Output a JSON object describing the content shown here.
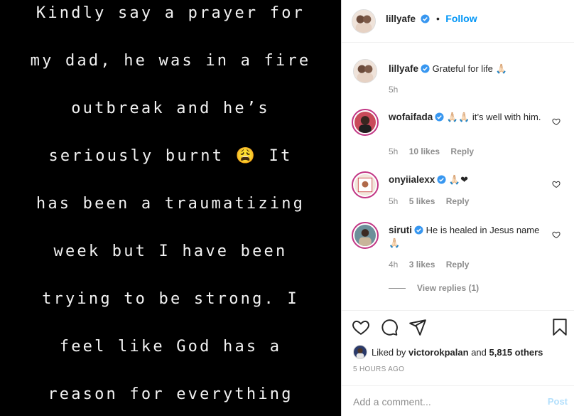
{
  "story_image": {
    "lines": [
      "Kindly say a prayer for",
      "my dad, he was in a fire",
      "outbreak and he’s",
      "seriously burnt 😩 It",
      "has been a traumatizing",
      "week but I have been",
      "trying to be strong. I",
      "feel like God has a",
      "reason for everything"
    ]
  },
  "header": {
    "username": "lillyafe",
    "dot": "•",
    "follow_label": "Follow"
  },
  "caption": {
    "username": "lillyafe",
    "text": "Grateful for life 🙏🏻",
    "time": "5h"
  },
  "comments": [
    {
      "username": "wofaifada",
      "text": "🙏🏻🙏🏻 it’s well with him.",
      "time": "5h",
      "likes": "10 likes",
      "reply": "Reply"
    },
    {
      "username": "onyiialexx",
      "text": "🙏🏻❤",
      "time": "5h",
      "likes": "5 likes",
      "reply": "Reply"
    },
    {
      "username": "siruti",
      "text": "He is healed in Jesus name 🙏🏻",
      "time": "4h",
      "likes": "3 likes",
      "reply": "Reply"
    }
  ],
  "view_replies": "View replies (1)",
  "likes": {
    "prefix": "Liked by",
    "user": "victorokpalan",
    "conj": "and",
    "others": "5,815 others"
  },
  "post_time": "5 HOURS AGO",
  "add_comment": {
    "placeholder": "Add a comment...",
    "post_label": "Post"
  },
  "colors": {
    "accent": "#0095f6",
    "post_disabled": "#b2dffc",
    "muted": "#8e8e8e",
    "verified": "#3897f0"
  },
  "icons": [
    "verified-badge-icon",
    "heart-icon",
    "comment-icon",
    "share-icon",
    "bookmark-icon"
  ]
}
